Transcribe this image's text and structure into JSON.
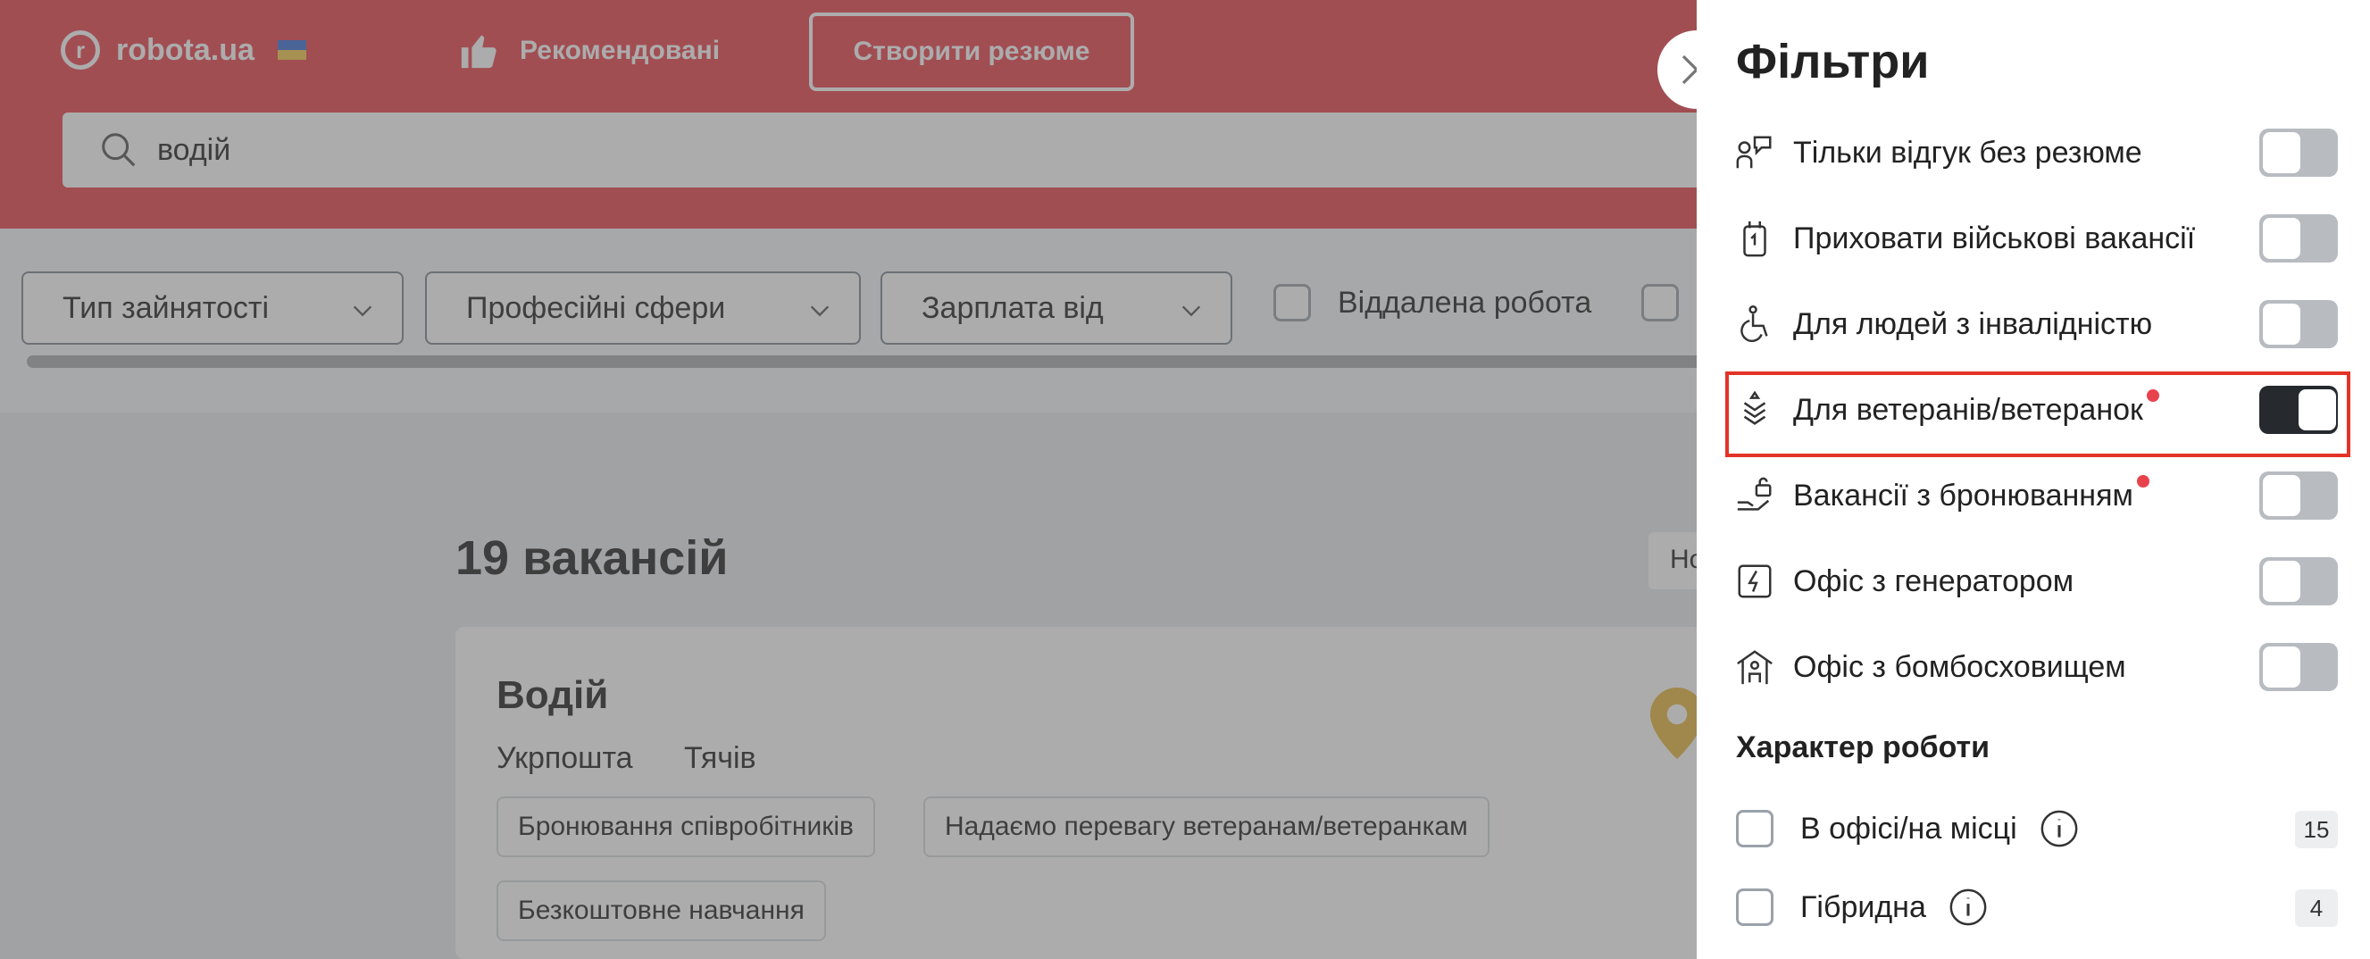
{
  "header": {
    "logo_text": "robota.ua",
    "recommended_label": "Рекомендовані",
    "create_cv_label": "Створити резюме",
    "brand_color": "#e8424d"
  },
  "search": {
    "value": "водій"
  },
  "quick_filters": {
    "employment_type": "Тип зайнятості",
    "professional_areas": "Професійні сфери",
    "salary_from": "Зарплата від",
    "remote_work": "Віддалена робота"
  },
  "results": {
    "count_label": "19 вакансій",
    "sort_partial": "Но"
  },
  "vacancy_card": {
    "title": "Водій",
    "company": "Укрпошта",
    "city": "Тячів",
    "tags": [
      "Бронювання співробітників",
      "Надаємо перевагу ветеранам/ветеранкам",
      "Безкоштовне навчання"
    ]
  },
  "filters_panel": {
    "title": "Фільтри",
    "toggles": [
      {
        "label": "Тільки відгук без резюме",
        "icon": "chat-person-icon",
        "on": false,
        "new_dot": false
      },
      {
        "label": "Приховати військові вакансії",
        "icon": "military-tag-icon",
        "on": false,
        "new_dot": false
      },
      {
        "label": "Для людей з інвалідністю",
        "icon": "wheelchair-icon",
        "on": false,
        "new_dot": false
      },
      {
        "label": "Для ветеранів/ветеранок",
        "icon": "veteran-badge-icon",
        "on": true,
        "new_dot": true
      },
      {
        "label": "Вакансії з бронюванням",
        "icon": "reservation-lock-icon",
        "on": false,
        "new_dot": true
      },
      {
        "label": "Офіс з генератором",
        "icon": "generator-icon",
        "on": false,
        "new_dot": false
      },
      {
        "label": "Офіс з бомбосховищем",
        "icon": "shelter-icon",
        "on": false,
        "new_dot": false
      }
    ],
    "work_type_section": "Характер роботи",
    "work_types": [
      {
        "label": "В офісі/на місці",
        "count": "15"
      },
      {
        "label": "Гібридна",
        "count": "4"
      }
    ],
    "highlight_color": "#e33326"
  }
}
